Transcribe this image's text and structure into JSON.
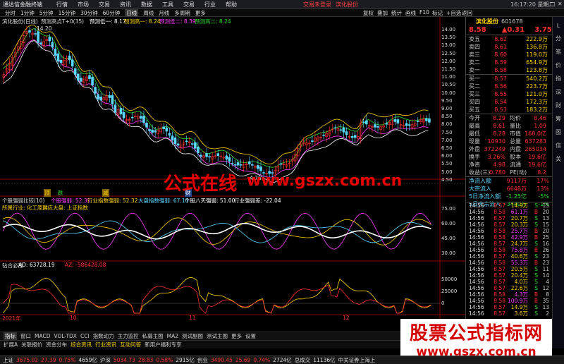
{
  "menubar": {
    "logo": "通达信金融终端",
    "items": [
      "行情",
      "市场",
      "交易",
      "资讯",
      "数据",
      "工具",
      "交易",
      "行业",
      "帮助"
    ],
    "alert": "交易未登录",
    "alert2": "滨化股份",
    "clock": "16:17:20",
    "clock_day": "星期二"
  },
  "toolbar": {
    "periods": [
      "分时",
      "1分钟",
      "5分钟",
      "15分钟",
      "30分钟",
      "60分钟",
      "日线",
      "周线",
      "月线",
      "多周期",
      "更多"
    ],
    "active": "日线",
    "right_buttons": [
      "复权",
      "叠加",
      "统计",
      "画线",
      "F10",
      "标记",
      "+自选",
      "返回"
    ]
  },
  "main_chart": {
    "title": "滨化股份(日线)",
    "indicator_title": "预测高点T+0(35)",
    "legend": [
      {
        "label": "预测低一: 8.17",
        "color": "#ffffff"
      },
      {
        "label": "预测高一: 8.24",
        "color": "#ffd400"
      },
      {
        "label": "预测低二: 8.39",
        "color": "#ff40ff"
      },
      {
        "label": "预测高二: 8.24",
        "color": "#30e030"
      }
    ],
    "high_label": "14.20",
    "low_label": "4.76",
    "price_axis": [
      "14.00",
      "13.50",
      "13.00",
      "12.50",
      "12.00",
      "11.50",
      "11.00",
      "10.50",
      "10.00",
      "9.50",
      "9.00",
      "8.50",
      "8.00",
      "7.50",
      "7.00",
      "6.50",
      "6.00",
      "5.50",
      "5.00",
      "4.50"
    ],
    "markers": [
      "顶",
      "跌",
      "减",
      "财"
    ]
  },
  "sub1": {
    "title": "个股强弱比较(10)",
    "legend": [
      {
        "label": "个股强弱: 52.35",
        "color": "#ff40ff"
      },
      {
        "label": "行业指数强弱: 52.32",
        "color": "#ffd400"
      },
      {
        "label": "大盘指数强弱: 67.10",
        "color": "#5ad7ff"
      },
      {
        "label": "个股八天强弱: 51.00",
        "color": "#ffffff"
      },
      {
        "label": "行业强弱差: -22.04",
        "color": "#ffffff"
      }
    ],
    "info1": "所属行业: 化工原料",
    "info2": "对应大盘: 上证指数",
    "axis": [
      "75.00",
      "60.00",
      "45.00",
      "30.00"
    ]
  },
  "sub2": {
    "title": "钻合必涨",
    "legend": [
      {
        "label": "AD: 63728.19",
        "color": "#ffffff"
      },
      {
        "label": "AZ: -586428.08",
        "color": "#ff3030"
      }
    ],
    "axis": [
      "50000",
      "25000",
      "0"
    ],
    "dates": [
      "2021年",
      "10",
      "11",
      "12"
    ]
  },
  "stock": {
    "name": "滨化股份",
    "code": "601678",
    "price": "8.58",
    "change": "▲0.31",
    "pct": "3.75%",
    "asks": [
      {
        "label": "卖五",
        "price": "8.62",
        "vol": "222.9万"
      },
      {
        "label": "卖四",
        "price": "8.61",
        "vol": "136.8万"
      },
      {
        "label": "卖三",
        "price": "8.60",
        "vol": "119.0万"
      },
      {
        "label": "卖二",
        "price": "8.59",
        "vol": "654.9万"
      },
      {
        "label": "卖一",
        "price": "8.58",
        "vol": "123.8万"
      }
    ],
    "bids": [
      {
        "label": "买一",
        "price": "8.57",
        "vol": "540.2万"
      },
      {
        "label": "买二",
        "price": "8.56",
        "vol": "223.7万"
      },
      {
        "label": "买三",
        "price": "8.55",
        "vol": "121.0万"
      },
      {
        "label": "买四",
        "price": "8.54",
        "vol": "172.3万"
      },
      {
        "label": "买五",
        "price": "8.53",
        "vol": "183.2万"
      }
    ],
    "stats": [
      {
        "a": "今开",
        "b": "8.29",
        "c": "均价",
        "d": "8.46"
      },
      {
        "a": "最高",
        "b": "8.61",
        "c": "量比",
        "d": "1.09"
      },
      {
        "a": "最低",
        "b": "8.28",
        "c": "市值",
        "d": "168.0亿"
      },
      {
        "a": "现量",
        "b": "10930",
        "c": "总量",
        "d": "637283"
      },
      {
        "a": "外盘",
        "b": "372249",
        "c": "内盘",
        "d": "265034"
      },
      {
        "a": "换手",
        "b": "3.26%",
        "c": "股本",
        "d": "19.6亿"
      },
      {
        "a": "净资",
        "b": "4.98",
        "c": "流通",
        "d": "19.6亿"
      },
      {
        "a": "收益(三)",
        "b": "0.780",
        "c": "PE(动)",
        "d": "8.2"
      }
    ],
    "flows": [
      {
        "label": "净流入额",
        "b": "9117万",
        "c": "17%"
      },
      {
        "label": "大宗流入",
        "b": "6648万",
        "c": "13%"
      },
      {
        "label": "5日净流入额",
        "b": "-1.25亿",
        "c": "-5%"
      },
      {
        "label": "5日大宗流入",
        "b": "-3440万",
        "c": "-1%"
      }
    ]
  },
  "ticks": [
    {
      "t": "14:56",
      "p": "8.57",
      "v": "14.9万",
      "s": "S",
      "n": "15"
    },
    {
      "t": "14:56",
      "p": "8.58",
      "v": "61.1万",
      "s": "B",
      "n": "20"
    },
    {
      "t": "14:56",
      "p": "8.57",
      "v": "20.7万",
      "s": "S",
      "n": "13"
    },
    {
      "t": "14:56",
      "p": "8.57",
      "v": "20.3万",
      "s": "S",
      "n": "15"
    },
    {
      "t": "14:56",
      "p": "8.58",
      "v": "25.7万",
      "s": "B",
      "n": "20"
    },
    {
      "t": "14:56",
      "p": "8.58",
      "v": "42.9万",
      "s": "B",
      "n": "25"
    },
    {
      "t": "14:56",
      "p": "8.57",
      "v": "24.7万",
      "s": "S",
      "n": "16"
    },
    {
      "t": "14:56",
      "p": "8.58",
      "v": "75.8万",
      "s": "B",
      "n": "26"
    },
    {
      "t": "14:56",
      "p": "8.57",
      "v": "40.6万",
      "s": "S",
      "n": "23"
    },
    {
      "t": "14:56",
      "p": "8.58",
      "v": "55.3万",
      "s": "B",
      "n": "23"
    },
    {
      "t": "14:56",
      "p": "8.57",
      "v": "20.5万",
      "s": "S",
      "n": "11"
    },
    {
      "t": "14:56",
      "p": "8.57",
      "v": "20.4万",
      "s": "S",
      "n": "14"
    },
    {
      "t": "14:56",
      "p": "8.57",
      "v": "4.0万",
      "s": "S",
      "n": "4"
    },
    {
      "t": "14:56",
      "p": "8.57",
      "v": "22.6万",
      "s": "S",
      "n": "12"
    },
    {
      "t": "14:56",
      "p": "8.58",
      "v": "4.3万",
      "s": "B",
      "n": "8"
    },
    {
      "t": "14:56",
      "p": "8.58",
      "v": "100.9万",
      "s": "B",
      "n": "35"
    },
    {
      "t": "14:56",
      "p": "8.57",
      "v": "14.9万",
      "s": "S",
      "n": "13"
    },
    {
      "t": "14:56",
      "p": "8.57",
      "v": "3.6万",
      "s": "S",
      "n": "2"
    }
  ],
  "tabs": {
    "row1": [
      "指标",
      "窗口",
      "MACD",
      "VOL-TDX",
      "CCI",
      "指数动力",
      "主力监控",
      "私募主图",
      "MA2",
      "测试副图",
      "测试主图",
      "更多",
      "设置"
    ],
    "row1_active": "指标",
    "row2": [
      "扩展A",
      "关联报价",
      "资金分布",
      "综合资讯",
      "行业资讯",
      "互动问答",
      "新用户福利专享"
    ]
  },
  "statusbar": {
    "items": [
      {
        "t": "上证",
        "c": "wht"
      },
      {
        "t": "3675.02",
        "c": "red"
      },
      {
        "t": "27.39",
        "c": "red"
      },
      {
        "t": "0.75%",
        "c": "red"
      },
      {
        "t": "4659亿",
        "c": "wht"
      },
      {
        "t": "沪深",
        "c": "wht"
      },
      {
        "t": "5034.73",
        "c": "red"
      },
      {
        "t": "28.83",
        "c": "red"
      },
      {
        "t": "0.58%",
        "c": "red"
      },
      {
        "t": "2915亿",
        "c": "wht"
      },
      {
        "t": "创业",
        "c": "wht"
      },
      {
        "t": "3490.45",
        "c": "red"
      },
      {
        "t": "25.69",
        "c": "red"
      },
      {
        "t": "0.74%",
        "c": "red"
      },
      {
        "t": "2724亿",
        "c": "wht"
      },
      {
        "t": "总成交",
        "c": "wht"
      },
      {
        "t": "11136亿",
        "c": "wht"
      },
      {
        "t": "中关证券上海上",
        "c": "wht"
      }
    ]
  },
  "watermark": {
    "a": "公式在线",
    "b": "www.gszx.com.cn"
  },
  "stamp": {
    "big": "股票公式指标网",
    "small": "www.gszx.com.cn"
  },
  "rightbar": [
    "L",
    "分",
    "笔",
    "价",
    "指",
    "深",
    "财",
    "筹",
    "图",
    "信",
    "关"
  ]
}
